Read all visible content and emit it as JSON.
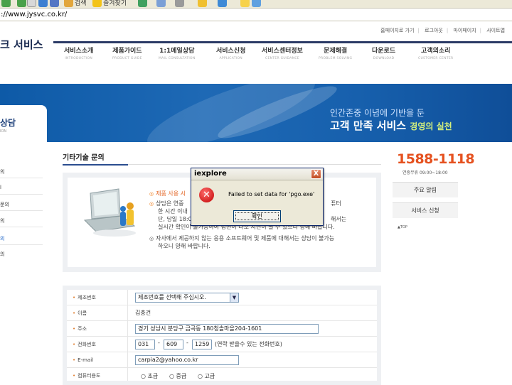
{
  "browser": {
    "address": "://www.jysvc.co.kr/",
    "toolbar_icons": [
      "back-icon",
      "forward-icon",
      "stop-icon",
      "refresh-icon",
      "home-icon",
      "search-icon",
      "favorites-icon",
      "history-icon",
      "mail-icon",
      "print-icon",
      "folder-icon",
      "messenger-icon"
    ],
    "toolbar_labels": {
      "search": "검색",
      "favorites": "즐겨찾기"
    }
  },
  "header": {
    "logo_text": "크 서비스",
    "util_links": [
      "홈페이지로 가기",
      "로그아웃",
      "마이페이지",
      "사이트맵"
    ],
    "nav": [
      {
        "ko": "서비스소개",
        "en": "INTRODUCTION"
      },
      {
        "ko": "제품가이드",
        "en": "PRODUCT GUIDE"
      },
      {
        "ko": "1:1메일상담",
        "en": "MAIL CONSULTATION"
      },
      {
        "ko": "서비스신청",
        "en": "APPLICATION"
      },
      {
        "ko": "서비스센터정보",
        "en": "CENTER GUIDANCE"
      },
      {
        "ko": "문제해결",
        "en": "PROBLEM SOLVING"
      },
      {
        "ko": "다운로드",
        "en": "DOWNLOAD"
      },
      {
        "ko": "고객의소리",
        "en": "CUSTOMER CENTER"
      }
    ]
  },
  "banner": {
    "line1": "인간존중 이념에 기반을 둔",
    "line2": "고객 만족 서비스",
    "line2_tail": "경영의 실천",
    "side_title": "상담",
    "side_sub": "ION"
  },
  "left_menu": [
    "의",
    "l",
    "문의",
    "의",
    "의",
    "의"
  ],
  "content": {
    "title": "기타기술 문의",
    "notice_head": "제품 사용 시",
    "notice_lines": [
      "상담은 연중",
      "한 시간 이내",
      "단, 당일 18:0",
      "실시간 확인이 불가능하여 답변이 다소 지연이 될 수 있으니 양해 바랍니다."
    ],
    "notice_right": [
      "퓨터",
      "해서는"
    ],
    "notice2_lines": [
      "자사에서 제공하지 않는 응용 소프트웨어 및 제품에 대해서는 상담이 불가능",
      "하오니 양해 바랍니다."
    ]
  },
  "form": {
    "rows": [
      {
        "label": "제조번호",
        "value": "제조번호를 선택해 주십시오."
      },
      {
        "label": "이름",
        "value": "김충건"
      },
      {
        "label": "주소",
        "value": "경기 성남시 분당구 금곡동 180청솔마을204-1601"
      },
      {
        "label": "전화번호",
        "p1": "031",
        "p2": "609",
        "p3": "1259",
        "note": "(연락 받을수 있는 전화번호)"
      },
      {
        "label": "E-mail",
        "value": "carpia2@yahoo.co.kr"
      },
      {
        "label": "컴퓨터용도",
        "options": [
          "○ 초급",
          "○ 중급",
          "○ 고급"
        ]
      }
    ]
  },
  "sidebar": {
    "phone": "1588-1118",
    "hours": "연중무휴 09:00~18:00",
    "buttons": [
      "주요 알림",
      "서비스 신청"
    ],
    "top": "▲TOP"
  },
  "dialog": {
    "title": "iexplore",
    "close": "X",
    "message": "Failed to set data for 'pgo.exe'",
    "ok": "확인"
  },
  "colors": {
    "accent": "#2b3a66",
    "phone": "#e5511f",
    "banner": "#1760ad",
    "highlight": "#ef7d1a"
  }
}
